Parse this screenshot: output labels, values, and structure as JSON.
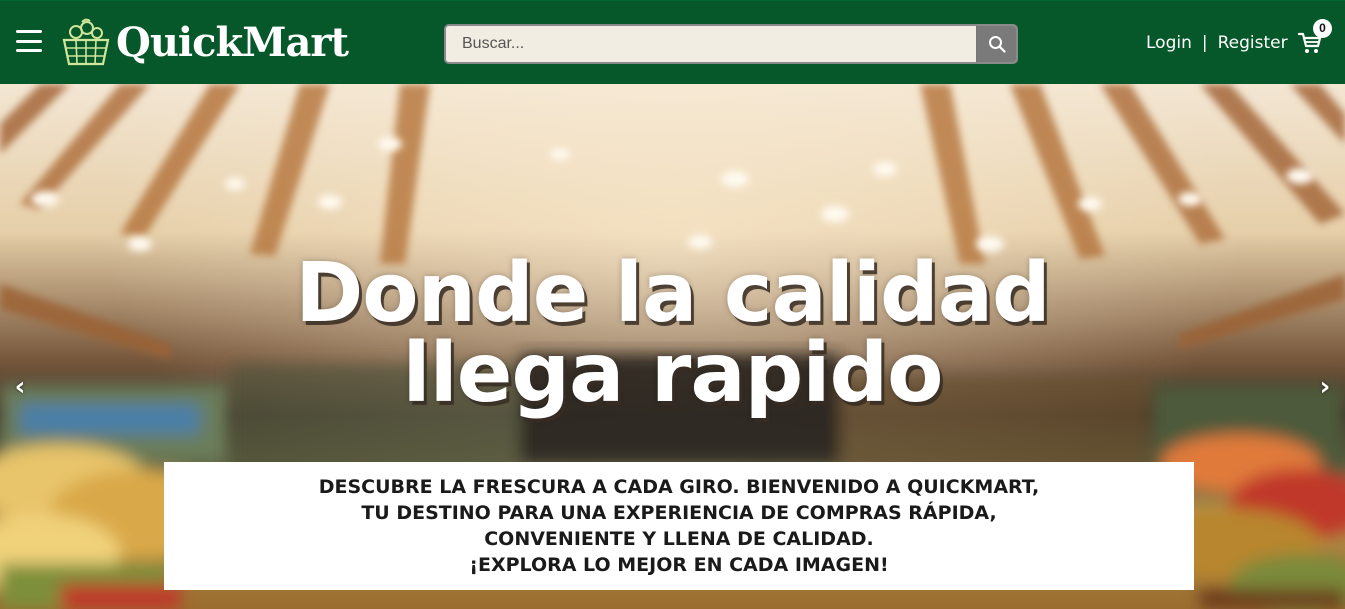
{
  "header": {
    "brand": "QuickMart",
    "search_placeholder": "Buscar...",
    "login_label": "Login",
    "separator": "|",
    "register_label": "Register",
    "cart_count": "0"
  },
  "hero": {
    "headline_line1": "Donde la calidad",
    "headline_line2": "llega rapido",
    "tagline": [
      "DESCUBRE LA FRESCURA A CADA GIRO. BIENVENIDO A QUICKMART,",
      "TU DESTINO PARA UNA EXPERIENCIA DE COMPRAS RÁPIDA,",
      "CONVENIENTE Y LLENA DE CALIDAD.",
      "¡EXPLORA LO MEJOR EN CADA IMAGEN!"
    ],
    "prev_arrow": "‹",
    "next_arrow": "›"
  },
  "colors": {
    "header_bg": "#06582a",
    "search_bg": "#f2ede3",
    "search_button_bg": "#7a7a7a"
  }
}
